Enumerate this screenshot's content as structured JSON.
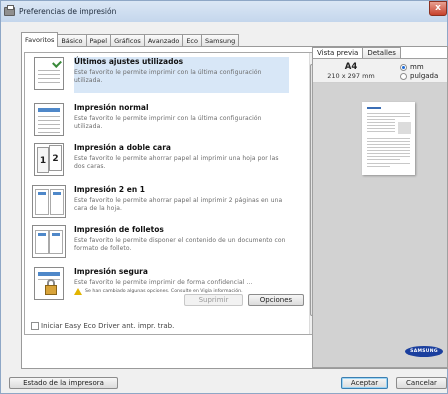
{
  "window": {
    "title": "Preferencias de impresión",
    "close_label": "x"
  },
  "tabs": [
    "Favoritos",
    "Básico",
    "Papel",
    "Gráficos",
    "Avanzado",
    "Eco",
    "Samsung"
  ],
  "favorites": [
    {
      "title": "Últimos ajustes utilizados",
      "desc": "Este favorito le permite imprimir con la última configuración utilizada."
    },
    {
      "title": "Impresión normal",
      "desc": "Este favorito le permite imprimir con la última configuración utilizada."
    },
    {
      "title": "Impresión a doble cara",
      "desc": "Este favorito le permite ahorrar papel al imprimir una hoja por las dos caras."
    },
    {
      "title": "Impresión 2 en 1",
      "desc": "Este favorito le permite ahorrar papel al imprimir 2 páginas en una cara de la hoja."
    },
    {
      "title": "Impresión de folletos",
      "desc": "Este favorito le permite disponer el contenido de un documento con formato de folleto."
    },
    {
      "title": "Impresión segura",
      "desc": "Este favorito le permite imprimir de forma confidencial ...",
      "warning": "Se han cambiado algunas opciones. Consulte en Vigía información."
    }
  ],
  "buttons": {
    "delete": "Suprimir",
    "options": "Opciones",
    "printer_status": "Estado de la impresora",
    "accept": "Aceptar",
    "cancel": "Cancelar"
  },
  "eco_checkbox": "Iniciar Easy Eco Driver ant. impr. trab.",
  "preview": {
    "tabs": [
      "Vista previa",
      "Detalles"
    ],
    "paper_size": "A4",
    "paper_dimensions": "210 x 297 mm",
    "units": [
      "mm",
      "pulgada"
    ],
    "selected_unit": "mm",
    "brand": "SAMSUNG"
  }
}
